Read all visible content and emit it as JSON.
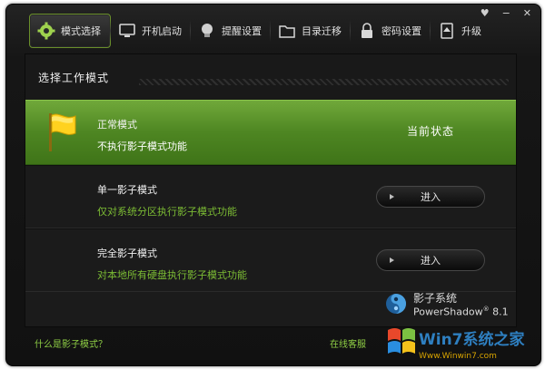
{
  "window": {
    "controls": [
      {
        "name": "skin-icon",
        "glyph": "♥"
      },
      {
        "name": "minimize-icon",
        "glyph": "−"
      },
      {
        "name": "close-icon",
        "glyph": "✕"
      }
    ]
  },
  "tabs": [
    {
      "name": "tab-mode-select",
      "label": "模式选择",
      "icon": "gear-icon",
      "active": true
    },
    {
      "name": "tab-startup",
      "label": "开机启动",
      "icon": "monitor-icon",
      "active": false
    },
    {
      "name": "tab-reminder",
      "label": "提醒设置",
      "icon": "lightbulb-icon",
      "active": false
    },
    {
      "name": "tab-dir-migrate",
      "label": "目录迁移",
      "icon": "folder-icon",
      "active": false
    },
    {
      "name": "tab-password",
      "label": "密码设置",
      "icon": "lock-icon",
      "active": false
    },
    {
      "name": "tab-upgrade",
      "label": "升级",
      "icon": "upgrade-icon",
      "active": false
    }
  ],
  "panel": {
    "title": "选择工作模式",
    "modes": [
      {
        "name": "正常模式",
        "desc": "不执行影子模式功能",
        "status": "当前状态",
        "current": true
      },
      {
        "name": "单一影子模式",
        "desc": "仅对系统分区执行影子模式功能",
        "button": "进入",
        "current": false
      },
      {
        "name": "完全影子模式",
        "desc": "对本地所有硬盘执行影子模式功能",
        "button": "进入",
        "current": false
      }
    ]
  },
  "brand": {
    "cn": "影子系统",
    "en": "PowerShadow",
    "version": "8.1"
  },
  "footer": {
    "help_link": "什么是影子模式？",
    "service_link": "在线客服"
  },
  "watermark": {
    "text": "Win7系统之家",
    "url": "Www.Winwin7.com"
  },
  "colors": {
    "accent_green": "#4e8622",
    "link_green": "#8fcf45"
  }
}
